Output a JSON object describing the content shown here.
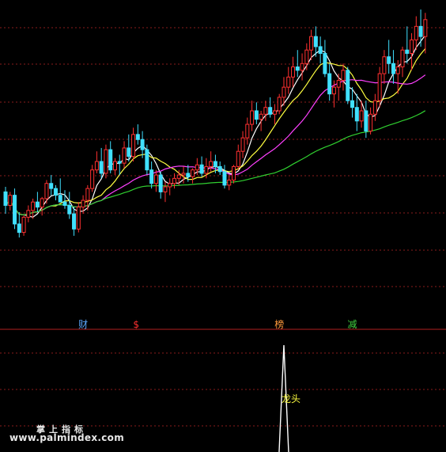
{
  "chart_data": [
    {
      "type": "candlestick",
      "grid": "dashed horizontal",
      "colors": {
        "up": "#ff3030",
        "down": "#40e0ff",
        "ma_short": "#ffffff",
        "ma_mid": "#ffff40",
        "ma_long": "#ff40ff",
        "ma_slow": "#30d030",
        "grid": "#8a1c1c"
      },
      "ylim": [
        0,
        100
      ],
      "candles": [
        [
          42,
          45,
          29,
          34
        ],
        [
          34,
          42,
          31,
          40
        ],
        [
          40,
          44,
          20,
          23
        ],
        [
          23,
          30,
          15,
          18
        ],
        [
          18,
          28,
          16,
          27
        ],
        [
          27,
          34,
          24,
          31
        ],
        [
          31,
          38,
          26,
          36
        ],
        [
          36,
          42,
          30,
          33
        ],
        [
          33,
          39,
          28,
          38
        ],
        [
          38,
          49,
          35,
          47
        ],
        [
          47,
          52,
          40,
          44
        ],
        [
          44,
          46,
          37,
          40
        ],
        [
          40,
          50,
          37,
          36
        ],
        [
          36,
          43,
          32,
          34
        ],
        [
          34,
          42,
          26,
          29
        ],
        [
          29,
          33,
          16,
          20
        ],
        [
          20,
          36,
          18,
          33
        ],
        [
          33,
          40,
          29,
          37
        ],
        [
          37,
          46,
          31,
          44
        ],
        [
          44,
          58,
          42,
          55
        ],
        [
          55,
          66,
          53,
          60
        ],
        [
          60,
          68,
          50,
          53
        ],
        [
          53,
          70,
          50,
          67
        ],
        [
          67,
          72,
          53,
          55
        ],
        [
          55,
          62,
          52,
          60
        ],
        [
          60,
          64,
          52,
          59
        ],
        [
          59,
          72,
          56,
          68
        ],
        [
          68,
          76,
          60,
          63
        ],
        [
          63,
          80,
          60,
          76
        ],
        [
          76,
          82,
          70,
          73
        ],
        [
          73,
          78,
          62,
          67
        ],
        [
          67,
          70,
          52,
          55
        ],
        [
          55,
          60,
          44,
          47
        ],
        [
          47,
          55,
          42,
          52
        ],
        [
          52,
          54,
          38,
          42
        ],
        [
          42,
          48,
          36,
          45
        ],
        [
          45,
          50,
          40,
          47
        ],
        [
          47,
          53,
          44,
          50
        ],
        [
          50,
          55,
          46,
          52
        ],
        [
          52,
          57,
          47,
          53
        ],
        [
          53,
          58,
          48,
          51
        ],
        [
          51,
          56,
          47,
          55
        ],
        [
          55,
          62,
          52,
          58
        ],
        [
          58,
          63,
          51,
          53
        ],
        [
          53,
          62,
          50,
          57
        ],
        [
          57,
          66,
          54,
          60
        ],
        [
          60,
          64,
          53,
          57
        ],
        [
          57,
          60,
          52,
          54
        ],
        [
          54,
          58,
          44,
          46
        ],
        [
          46,
          52,
          43,
          49
        ],
        [
          49,
          58,
          47,
          57
        ],
        [
          57,
          70,
          55,
          66
        ],
        [
          66,
          78,
          62,
          74
        ],
        [
          74,
          86,
          70,
          82
        ],
        [
          82,
          96,
          78,
          90
        ],
        [
          90,
          95,
          82,
          85
        ],
        [
          85,
          90,
          78,
          88
        ],
        [
          88,
          96,
          84,
          92
        ],
        [
          92,
          98,
          86,
          88
        ],
        [
          88,
          94,
          82,
          90
        ],
        [
          90,
          100,
          88,
          98
        ],
        [
          98,
          110,
          93,
          104
        ],
        [
          104,
          116,
          100,
          110
        ],
        [
          110,
          122,
          104,
          116
        ],
        [
          116,
          126,
          110,
          114
        ],
        [
          114,
          124,
          108,
          118
        ],
        [
          118,
          130,
          114,
          126
        ],
        [
          126,
          138,
          120,
          134
        ],
        [
          134,
          140,
          122,
          128
        ],
        [
          128,
          134,
          118,
          124
        ],
        [
          124,
          132,
          110,
          112
        ],
        [
          112,
          118,
          96,
          100
        ],
        [
          100,
          108,
          92,
          104
        ],
        [
          104,
          112,
          96,
          108
        ],
        [
          108,
          118,
          102,
          114
        ],
        [
          114,
          116,
          94,
          96
        ],
        [
          96,
          104,
          86,
          92
        ],
        [
          92,
          100,
          78,
          84
        ],
        [
          84,
          96,
          80,
          90
        ],
        [
          90,
          96,
          74,
          78
        ],
        [
          78,
          92,
          76,
          88
        ],
        [
          88,
          100,
          84,
          96
        ],
        [
          96,
          116,
          92,
          112
        ],
        [
          112,
          126,
          106,
          122
        ],
        [
          122,
          132,
          112,
          118
        ],
        [
          118,
          126,
          106,
          112
        ],
        [
          112,
          120,
          100,
          116
        ],
        [
          116,
          128,
          110,
          126
        ],
        [
          126,
          140,
          118,
          124
        ],
        [
          124,
          136,
          114,
          132
        ],
        [
          132,
          146,
          126,
          140
        ],
        [
          140,
          150,
          128,
          134
        ],
        [
          134,
          148,
          124,
          144
        ]
      ],
      "moving_averages": [
        {
          "color": "ma_short",
          "period": 5
        },
        {
          "color": "ma_mid",
          "period": 10
        },
        {
          "color": "ma_long",
          "period": 20
        },
        {
          "color": "ma_slow",
          "period": 60
        }
      ]
    },
    {
      "type": "indicator",
      "peak": {
        "at_candle": 61,
        "value": 1
      }
    }
  ],
  "signals": [
    {
      "label": "财",
      "color": "#5aa8ff",
      "at_candle": 17
    },
    {
      "label": "$",
      "color": "#ff3030",
      "at_candle": 29
    },
    {
      "label": "榜",
      "color": "#ff9a3c",
      "at_candle": 60
    },
    {
      "label": "减",
      "color": "#40d040",
      "at_candle": 76
    }
  ],
  "annotation": {
    "text": "龙头",
    "color": "#ffff40"
  },
  "watermark": {
    "title": "掌上指标",
    "url": "www.palmindex.com"
  }
}
